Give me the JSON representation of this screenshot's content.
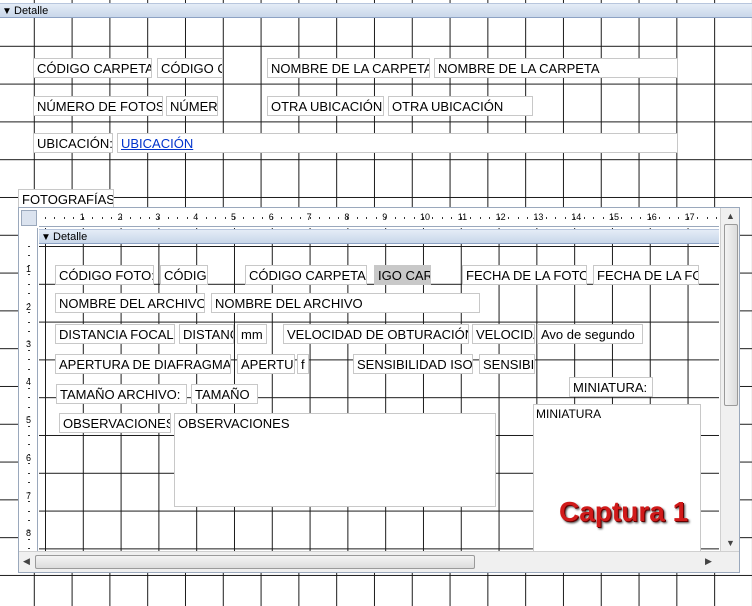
{
  "detail_header": {
    "label": "Detalle"
  },
  "main_form": {
    "codigo_carpeta_label": "CÓDIGO CARPETA:",
    "codigo_carpeta_field": "CÓDIGO C",
    "nombre_carpeta_label": "NOMBRE DE LA CARPETA:",
    "nombre_carpeta_field": "NOMBRE DE LA CARPETA",
    "numero_fotos_label": "NÚMERO DE FOTOS:",
    "numero_fotos_field": "NÚMER",
    "otra_ubicacion_label": "OTRA UBICACIÓN:",
    "otra_ubicacion_field": "OTRA UBICACIÓN",
    "ubicacion_label": "UBICACIÓN:",
    "ubicacion_field": "UBICACIÓN",
    "fotografias_label": "FOTOGRAFÍAS:"
  },
  "subform": {
    "detail_header": "Detalle",
    "h_ruler_numbers": [
      "1",
      "2",
      "3",
      "4",
      "5",
      "6",
      "7",
      "8",
      "9",
      "10",
      "11",
      "12",
      "13",
      "14",
      "15",
      "16",
      "17"
    ],
    "v_ruler_numbers": [
      "1",
      "2",
      "3",
      "4",
      "5",
      "6",
      "7",
      "8"
    ],
    "codigo_foto_label": "CÓDIGO FOTO:",
    "codigo_foto_field": "CÓDIG",
    "codigo_carpeta_label": "CÓDIGO CARPETA:",
    "codigo_carpeta_field": "IGO CAR",
    "fecha_foto_label": "FECHA DE LA FOTO:",
    "fecha_foto_field": "FECHA DE LA FOT",
    "nombre_archivo_label": "NOMBRE DEL ARCHIVO:",
    "nombre_archivo_field": "NOMBRE DEL ARCHIVO",
    "distancia_focal_label": "DISTANCIA FOCAL:",
    "distancia_focal_field": "DISTANC",
    "distancia_focal_unit": "mm",
    "velocidad_label": "VELOCIDAD DE OBTURACIÓN:",
    "velocidad_field": "VELOCIDA",
    "velocidad_unit": "Avo de segundo",
    "apertura_label": "APERTURA DE DIAFRAGMA:",
    "apertura_field": "APERTUF",
    "apertura_unit": "f",
    "sensibilidad_label": "SENSIBILIDAD ISO:",
    "sensibilidad_field": "SENSIBII",
    "miniatura_label": "MINIATURA:",
    "miniatura_field": "MINIATURA",
    "tamano_label": "TAMAÑO ARCHIVO:",
    "tamano_field": "TAMAÑO",
    "observaciones_label": "OBSERVACIONES:",
    "observaciones_field": "OBSERVACIONES"
  },
  "watermark": "Captura 1"
}
